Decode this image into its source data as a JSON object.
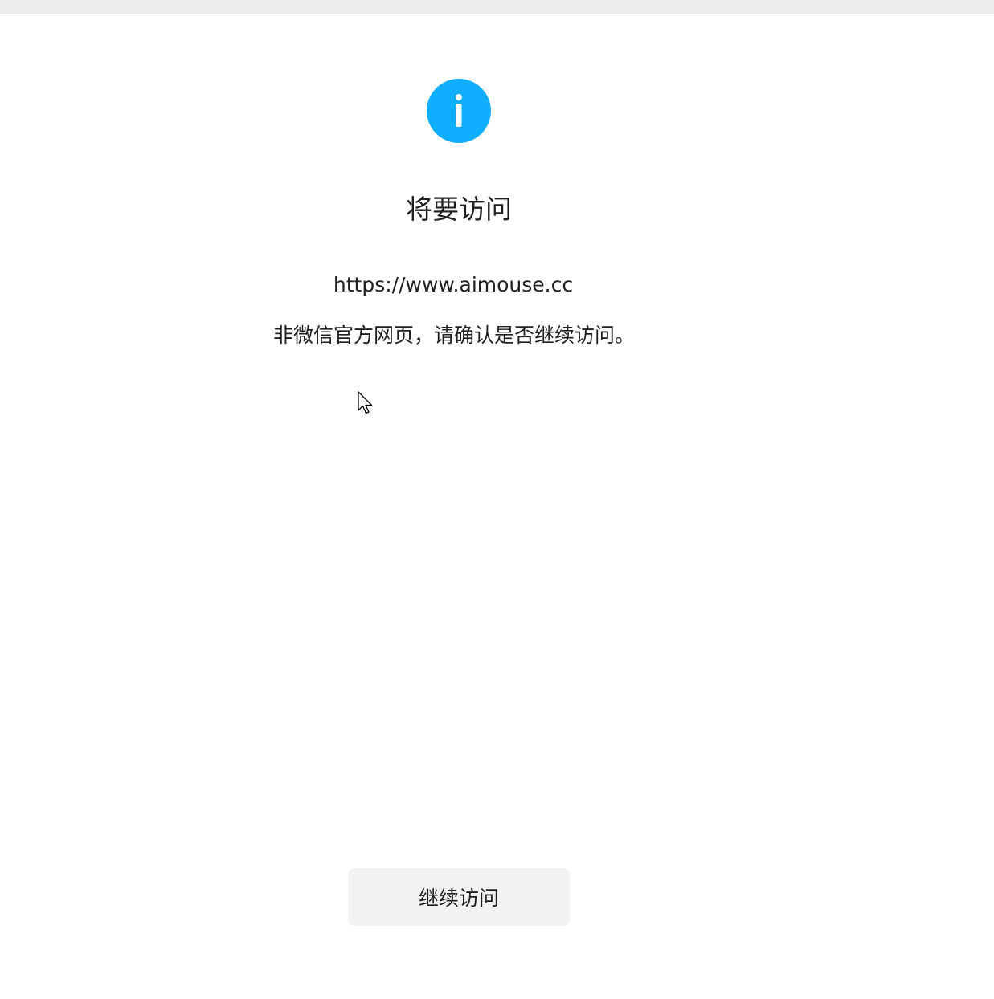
{
  "colors": {
    "accent": "#10AEFF",
    "top_bar": "#EDEDED",
    "button_bg": "#F2F2F2",
    "text": "#1F1F1F"
  },
  "icon": {
    "name": "info-icon"
  },
  "dialog": {
    "title": "将要访问",
    "url": "https://www.aimouse.cc",
    "warning": "非微信官方网页，请确认是否继续访问。",
    "continue_label": "继续访问"
  }
}
